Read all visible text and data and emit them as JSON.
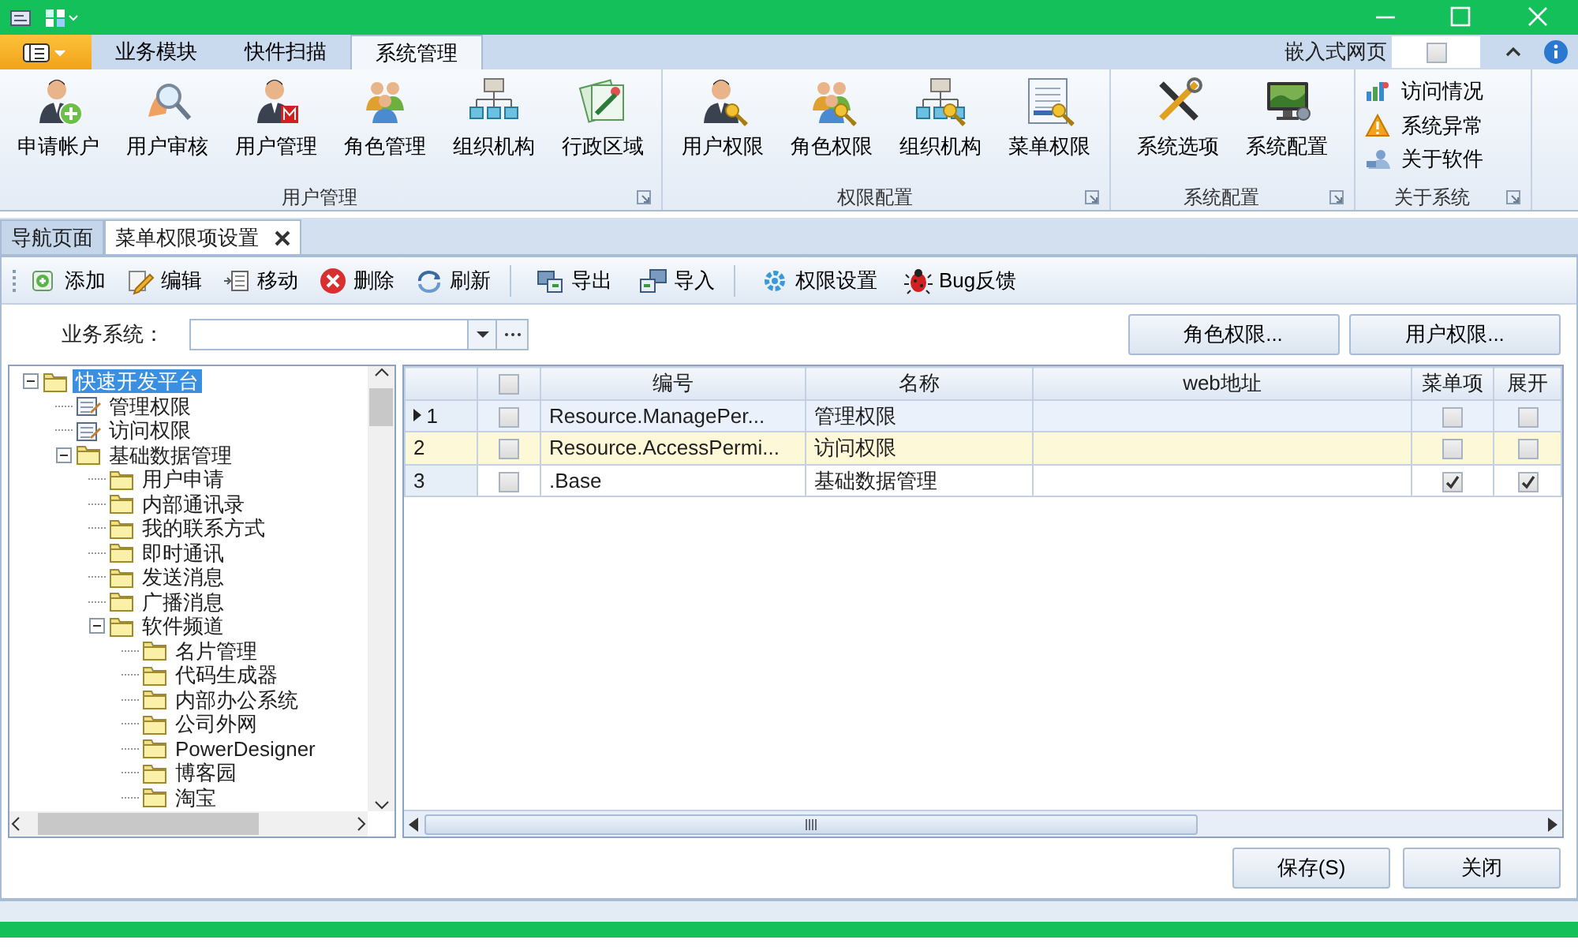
{
  "ribbon": {
    "tabs": [
      {
        "label": "业务模块",
        "selected": false
      },
      {
        "label": "快件扫描",
        "selected": false
      },
      {
        "label": "系统管理",
        "selected": true
      }
    ],
    "embed": {
      "label": "嵌入式网页",
      "checked": false
    },
    "groups": [
      {
        "label": "用户管理",
        "kind": "large",
        "items": [
          "申请帐户",
          "用户审核",
          "用户管理",
          "角色管理",
          "组织机构",
          "行政区域"
        ]
      },
      {
        "label": "权限配置",
        "kind": "large",
        "items": [
          "用户权限",
          "角色权限",
          "组织机构",
          "菜单权限"
        ]
      },
      {
        "label": "系统配置",
        "kind": "large",
        "items": [
          "系统选项",
          "系统配置"
        ]
      },
      {
        "label": "关于系统",
        "kind": "small",
        "items": [
          "访问情况",
          "系统异常",
          "关于软件"
        ]
      }
    ]
  },
  "doc_tabs": [
    {
      "label": "导航页面",
      "selected": false,
      "closable": false
    },
    {
      "label": "菜单权限项设置",
      "selected": true,
      "closable": true
    }
  ],
  "toolbar": [
    "添加",
    "编辑",
    "移动",
    "删除",
    "刷新",
    "导出",
    "导入",
    "权限设置",
    "Bug反馈"
  ],
  "filter": {
    "label": "业务系统：",
    "buttons": [
      "角色权限...",
      "用户权限..."
    ]
  },
  "tree": [
    {
      "label": "快速开发平台",
      "kind": "folder",
      "expanded": true,
      "selected": true,
      "children": [
        {
          "label": "管理权限",
          "kind": "doc",
          "selected": false
        },
        {
          "label": "访问权限",
          "kind": "doc",
          "selected": false
        },
        {
          "label": "基础数据管理",
          "kind": "folder",
          "expanded": true,
          "selected": false,
          "children": [
            {
              "label": "用户申请",
              "kind": "folder",
              "selected": false
            },
            {
              "label": "内部通讯录",
              "kind": "folder",
              "selected": false
            },
            {
              "label": "我的联系方式",
              "kind": "folder",
              "selected": false
            },
            {
              "label": "即时通讯",
              "kind": "folder",
              "selected": false
            },
            {
              "label": "发送消息",
              "kind": "folder",
              "selected": false
            },
            {
              "label": "广播消息",
              "kind": "folder",
              "selected": false
            },
            {
              "label": "软件频道",
              "kind": "folder",
              "expanded": true,
              "selected": false,
              "children": [
                {
                  "label": "名片管理",
                  "kind": "folder",
                  "selected": false
                },
                {
                  "label": "代码生成器",
                  "kind": "folder",
                  "selected": false
                },
                {
                  "label": "内部办公系统",
                  "kind": "folder",
                  "selected": false
                },
                {
                  "label": "公司外网",
                  "kind": "folder",
                  "selected": false
                },
                {
                  "label": "PowerDesigner",
                  "kind": "folder",
                  "selected": false
                },
                {
                  "label": "博客园",
                  "kind": "folder",
                  "selected": false
                },
                {
                  "label": "淘宝",
                  "kind": "folder",
                  "selected": false
                }
              ]
            }
          ]
        }
      ]
    }
  ],
  "grid": {
    "header_checked": false,
    "columns": [
      "编号",
      "名称",
      "web地址",
      "菜单项",
      "展开"
    ],
    "rows": [
      {
        "number": "1",
        "current": true,
        "selected": false,
        "checked": false,
        "code": "Resource.ManagePer...",
        "name": "管理权限",
        "menu": false,
        "expand": false
      },
      {
        "number": "2",
        "current": false,
        "selected": true,
        "checked": false,
        "code": "Resource.AccessPermi...",
        "name": "访问权限",
        "menu": false,
        "expand": false
      },
      {
        "number": "3",
        "current": false,
        "selected": false,
        "checked": false,
        "code": ".Base",
        "name": "基础数据管理",
        "menu": true,
        "expand": true
      }
    ]
  },
  "footer_buttons": [
    "保存(S)",
    "关闭"
  ]
}
